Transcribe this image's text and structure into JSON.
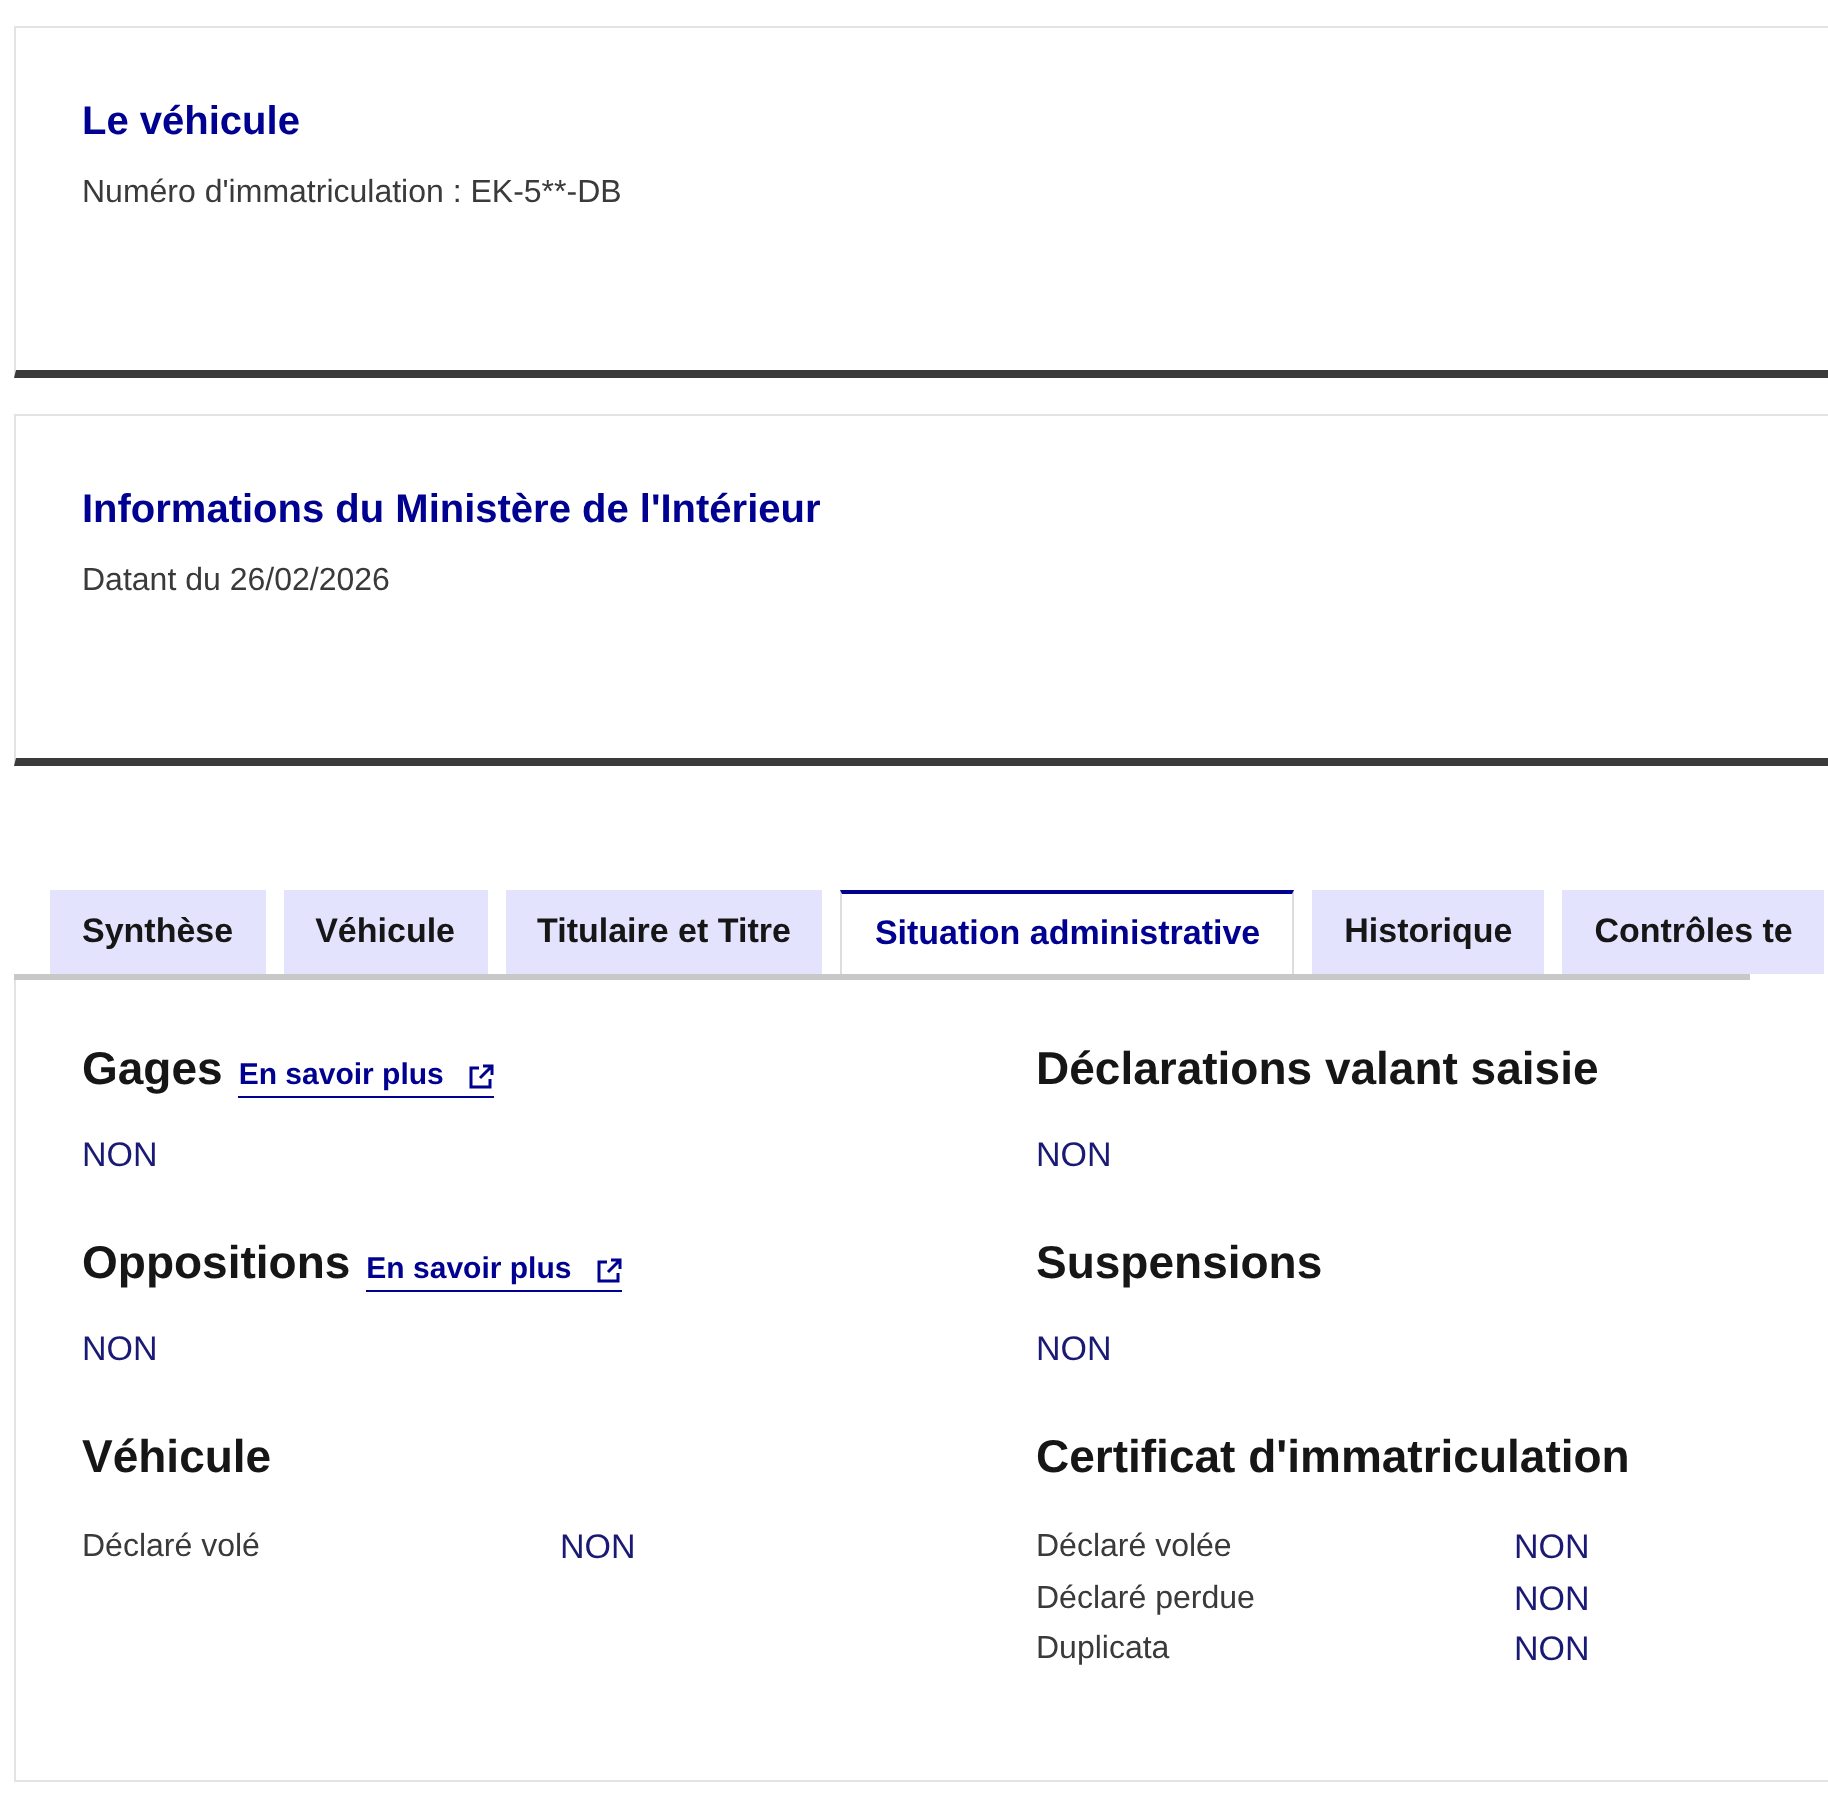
{
  "cards": [
    {
      "title": "Le véhicule",
      "subtitle": "Numéro d'immatriculation : EK-5**-DB"
    },
    {
      "title": "Informations du Ministère de l'Intérieur",
      "subtitle": "Datant du 26/02/2026"
    }
  ],
  "tabs": [
    {
      "label": "Synthèse",
      "selected": false
    },
    {
      "label": "Véhicule",
      "selected": false
    },
    {
      "label": "Titulaire et Titre",
      "selected": false
    },
    {
      "label": "Situation administrative",
      "selected": true
    },
    {
      "label": "Historique",
      "selected": false
    },
    {
      "label": "Contrôles te",
      "selected": false
    }
  ],
  "panel": {
    "columns": [
      {
        "sections": [
          {
            "kind": "status",
            "title": "Gages",
            "link": "En savoir plus",
            "value": "NON"
          },
          {
            "kind": "status",
            "title": "Oppositions",
            "link": "En savoir plus",
            "value": "NON"
          },
          {
            "kind": "table",
            "title": "Véhicule",
            "rows": [
              {
                "label": "Déclaré volé",
                "value": "NON"
              }
            ]
          }
        ]
      },
      {
        "sections": [
          {
            "kind": "status",
            "title": "Déclarations valant saisie",
            "value": "NON"
          },
          {
            "kind": "status",
            "title": "Suspensions",
            "value": "NON"
          },
          {
            "kind": "table",
            "title": "Certificat d'immatriculation",
            "rows": [
              {
                "label": "Déclaré volée",
                "value": "NON"
              },
              {
                "label": "Déclaré perdue",
                "value": "NON"
              },
              {
                "label": "Duplicata",
                "value": "NON"
              }
            ]
          }
        ]
      }
    ]
  }
}
